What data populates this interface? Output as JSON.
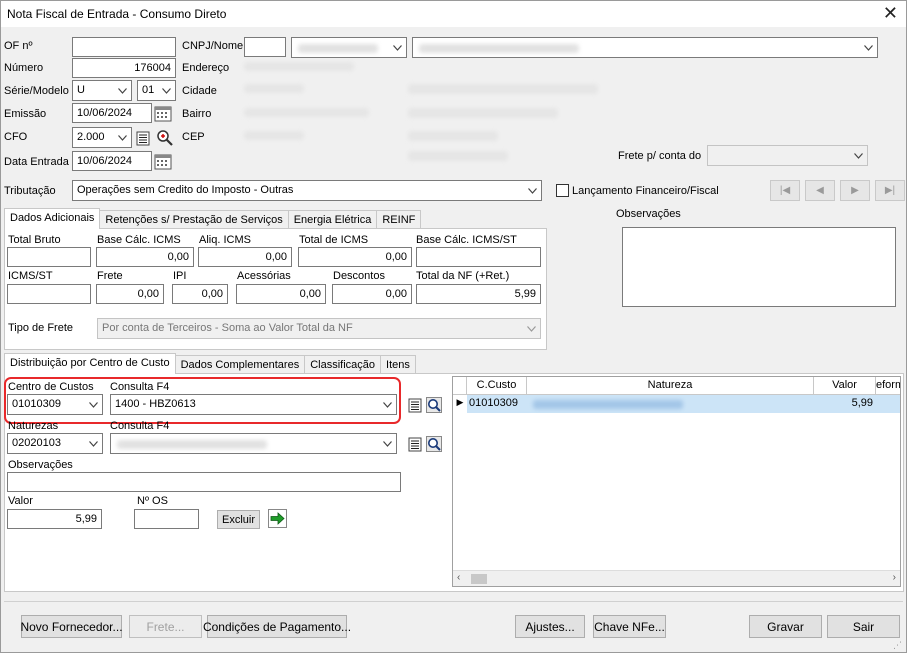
{
  "window": {
    "title": "Nota Fiscal de Entrada - Consumo Direto"
  },
  "header": {
    "of_label": "OF nº",
    "of_value": "",
    "numero_label": "Número",
    "numero_value": "176004",
    "serie_label": "Série/Modelo",
    "serie_value": "U",
    "modelo_value": "01",
    "emissao_label": "Emissão",
    "emissao_value": "10/06/2024",
    "cfo_label": "CFO",
    "cfo_value": "2.000",
    "data_entrada_label": "Data Entrada",
    "data_entrada_value": "10/06/2024",
    "cnpj_label": "CNPJ/Nome",
    "cnpj_value": "",
    "endereco_label": "Endereço",
    "cidade_label": "Cidade",
    "bairro_label": "Bairro",
    "cep_label": "CEP",
    "frete_conta_label": "Frete p/ conta do",
    "frete_conta_value": "",
    "tributacao_label": "Tributação",
    "tributacao_value": "Operações sem Credito do Imposto - Outras",
    "lancamento_label": "Lançamento Financeiro/Fiscal",
    "nav": [
      "|◀",
      "◀",
      "▶",
      "▶|"
    ]
  },
  "tabs_top": [
    "Dados Adicionais",
    "Retenções s/ Prestação de Serviços",
    "Energia Elétrica",
    "REINF"
  ],
  "observacoes_label": "Observações",
  "totals": {
    "total_bruto_label": "Total Bruto",
    "total_bruto": "",
    "base_icms_label": "Base Cálc. ICMS",
    "base_icms": "0,00",
    "aliq_icms_label": "Aliq. ICMS",
    "aliq_icms": "0,00",
    "total_icms_label": "Total de ICMS",
    "total_icms": "0,00",
    "base_icms_st_label": "Base Cálc. ICMS/ST",
    "base_icms_st": "",
    "icms_st_label": "ICMS/ST",
    "icms_st": "",
    "frete_label": "Frete",
    "frete": "0,00",
    "ipi_label": "IPI",
    "ipi": "0,00",
    "acessorias_label": "Acessórias",
    "acessorias": "0,00",
    "descontos_label": "Descontos",
    "descontos": "0,00",
    "total_nf_label": "Total da NF (+Ret.)",
    "total_nf": "5,99",
    "tipo_frete_label": "Tipo de Frete",
    "tipo_frete_value": "Por conta de Terceiros - Soma ao Valor Total da NF"
  },
  "tabs_bottom": [
    "Distribuição por Centro de Custo",
    "Dados Complementares",
    "Classificação",
    "Itens"
  ],
  "distribuicao": {
    "centro_custos_label": "Centro de Custos",
    "centro_custos_value": "01010309",
    "consulta_label": "Consulta F4",
    "consulta_value": "1400 - HBZ0613",
    "naturezas_label": "Naturezas",
    "naturezas_value": "02020103",
    "consulta2_label": "Consulta F4",
    "observacoes_label": "Observações",
    "observacoes_value": "",
    "valor_label": "Valor",
    "valor_value": "5,99",
    "nos_label": "Nº OS",
    "nos_value": "",
    "excluir_label": "Excluir"
  },
  "grid": {
    "headers": [
      "C.Custo",
      "Natureza",
      "Valor",
      "eform"
    ],
    "rows": [
      {
        "ccusto": "01010309",
        "valor": "5,99"
      }
    ]
  },
  "footer": {
    "novo_fornecedor": "Novo Fornecedor...",
    "frete": "Frete...",
    "condicoes": "Condições de Pagamento...",
    "ajustes": "Ajustes...",
    "chave_nfe": "Chave NFe...",
    "gravar": "Gravar",
    "sair": "Sair"
  },
  "colors": {
    "selection": "#cce4f7",
    "highlight_border": "#e8292b",
    "accent_green": "#1f9d2a"
  }
}
